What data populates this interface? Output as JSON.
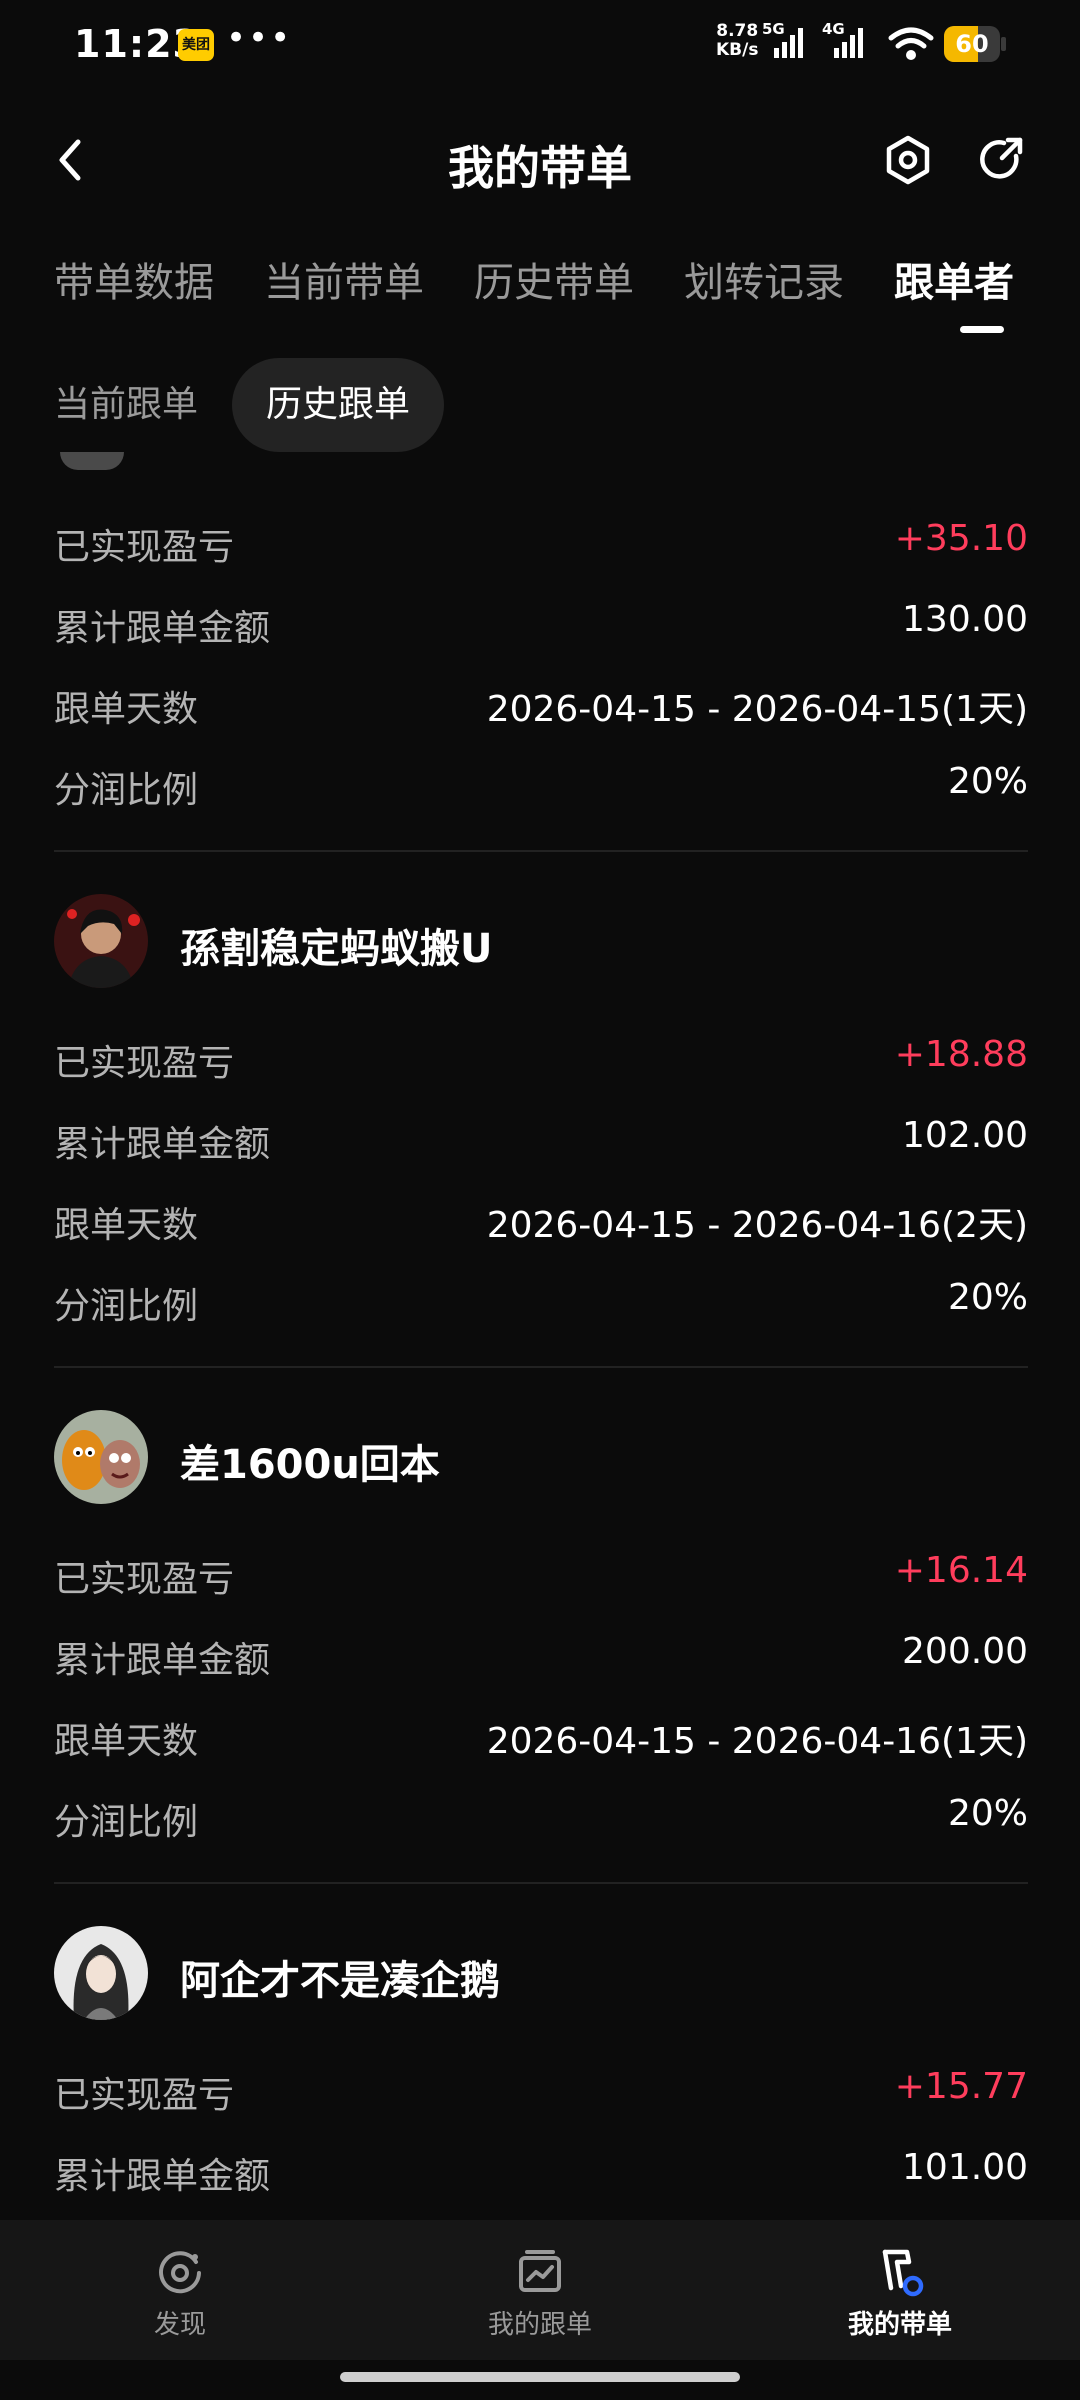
{
  "status_bar": {
    "time": "11:23",
    "app_badge": "美团",
    "more": "•••",
    "net_speed_value": "8.78",
    "net_speed_unit": "KB/s",
    "network_1": "5G",
    "network_2": "4G",
    "battery": "60",
    "battery_level": 0.6
  },
  "header": {
    "title": "我的带单",
    "back_icon": "chevron-left-icon",
    "settings_icon": "hexagon-settings-icon",
    "share_icon": "share-arrow-icon"
  },
  "tabs": [
    {
      "label": "带单数据",
      "active": false
    },
    {
      "label": "当前带单",
      "active": false
    },
    {
      "label": "历史带单",
      "active": false
    },
    {
      "label": "划转记录",
      "active": false
    },
    {
      "label": "跟单者",
      "active": true
    }
  ],
  "subtabs": [
    {
      "label": "当前跟单",
      "active": false
    },
    {
      "label": "历史跟单",
      "active": true
    }
  ],
  "labels": {
    "pnl": "已实现盈亏",
    "amount": "累计跟单金额",
    "days": "跟单天数",
    "share": "分润比例"
  },
  "followers": [
    {
      "name": "",
      "pnl": "+35.10",
      "amount": "130.00",
      "days": "2026-04-15 - 2026-04-15(1天)",
      "share": "20%"
    },
    {
      "name": "孫割稳定蚂蚁搬U",
      "pnl": "+18.88",
      "amount": "102.00",
      "days": "2026-04-15 - 2026-04-16(2天)",
      "share": "20%"
    },
    {
      "name": "差1600u回本",
      "pnl": "+16.14",
      "amount": "200.00",
      "days": "2026-04-15 - 2026-04-16(1天)",
      "share": "20%"
    },
    {
      "name": "阿企才不是凑企鹅",
      "pnl": "+15.77",
      "amount": "101.00"
    }
  ],
  "bottom_nav": [
    {
      "label": "发现",
      "icon": "discover-icon",
      "active": false
    },
    {
      "label": "我的跟单",
      "icon": "chart-box-icon",
      "active": false
    },
    {
      "label": "我的带单",
      "icon": "flag-trophy-icon",
      "active": true
    }
  ],
  "colors": {
    "background": "#0b0b0b",
    "profit": "#ff3d5c",
    "accent_blue": "#2f6bff",
    "battery": "#f5b800"
  }
}
